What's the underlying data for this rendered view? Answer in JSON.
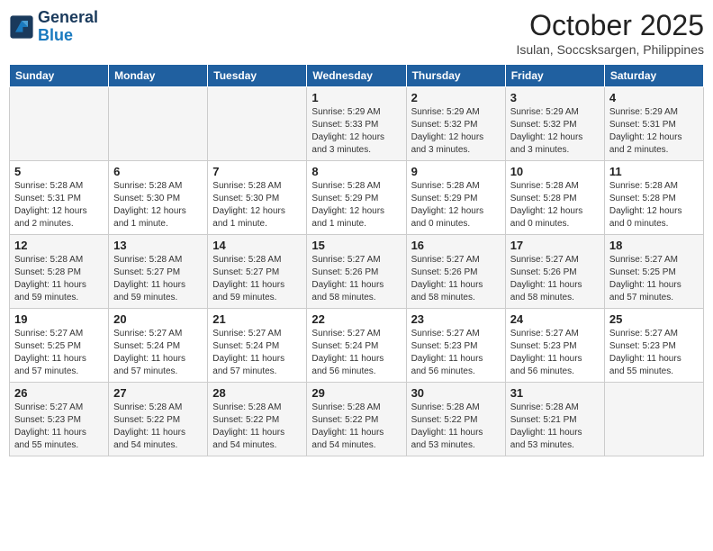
{
  "logo": {
    "line1": "General",
    "line2": "Blue"
  },
  "title": "October 2025",
  "location": "Isulan, Soccsksargen, Philippines",
  "weekdays": [
    "Sunday",
    "Monday",
    "Tuesday",
    "Wednesday",
    "Thursday",
    "Friday",
    "Saturday"
  ],
  "weeks": [
    [
      {
        "day": "",
        "sunrise": "",
        "sunset": "",
        "daylight": ""
      },
      {
        "day": "",
        "sunrise": "",
        "sunset": "",
        "daylight": ""
      },
      {
        "day": "",
        "sunrise": "",
        "sunset": "",
        "daylight": ""
      },
      {
        "day": "1",
        "sunrise": "Sunrise: 5:29 AM",
        "sunset": "Sunset: 5:33 PM",
        "daylight": "Daylight: 12 hours and 3 minutes."
      },
      {
        "day": "2",
        "sunrise": "Sunrise: 5:29 AM",
        "sunset": "Sunset: 5:32 PM",
        "daylight": "Daylight: 12 hours and 3 minutes."
      },
      {
        "day": "3",
        "sunrise": "Sunrise: 5:29 AM",
        "sunset": "Sunset: 5:32 PM",
        "daylight": "Daylight: 12 hours and 3 minutes."
      },
      {
        "day": "4",
        "sunrise": "Sunrise: 5:29 AM",
        "sunset": "Sunset: 5:31 PM",
        "daylight": "Daylight: 12 hours and 2 minutes."
      }
    ],
    [
      {
        "day": "5",
        "sunrise": "Sunrise: 5:28 AM",
        "sunset": "Sunset: 5:31 PM",
        "daylight": "Daylight: 12 hours and 2 minutes."
      },
      {
        "day": "6",
        "sunrise": "Sunrise: 5:28 AM",
        "sunset": "Sunset: 5:30 PM",
        "daylight": "Daylight: 12 hours and 1 minute."
      },
      {
        "day": "7",
        "sunrise": "Sunrise: 5:28 AM",
        "sunset": "Sunset: 5:30 PM",
        "daylight": "Daylight: 12 hours and 1 minute."
      },
      {
        "day": "8",
        "sunrise": "Sunrise: 5:28 AM",
        "sunset": "Sunset: 5:29 PM",
        "daylight": "Daylight: 12 hours and 1 minute."
      },
      {
        "day": "9",
        "sunrise": "Sunrise: 5:28 AM",
        "sunset": "Sunset: 5:29 PM",
        "daylight": "Daylight: 12 hours and 0 minutes."
      },
      {
        "day": "10",
        "sunrise": "Sunrise: 5:28 AM",
        "sunset": "Sunset: 5:28 PM",
        "daylight": "Daylight: 12 hours and 0 minutes."
      },
      {
        "day": "11",
        "sunrise": "Sunrise: 5:28 AM",
        "sunset": "Sunset: 5:28 PM",
        "daylight": "Daylight: 12 hours and 0 minutes."
      }
    ],
    [
      {
        "day": "12",
        "sunrise": "Sunrise: 5:28 AM",
        "sunset": "Sunset: 5:28 PM",
        "daylight": "Daylight: 11 hours and 59 minutes."
      },
      {
        "day": "13",
        "sunrise": "Sunrise: 5:28 AM",
        "sunset": "Sunset: 5:27 PM",
        "daylight": "Daylight: 11 hours and 59 minutes."
      },
      {
        "day": "14",
        "sunrise": "Sunrise: 5:28 AM",
        "sunset": "Sunset: 5:27 PM",
        "daylight": "Daylight: 11 hours and 59 minutes."
      },
      {
        "day": "15",
        "sunrise": "Sunrise: 5:27 AM",
        "sunset": "Sunset: 5:26 PM",
        "daylight": "Daylight: 11 hours and 58 minutes."
      },
      {
        "day": "16",
        "sunrise": "Sunrise: 5:27 AM",
        "sunset": "Sunset: 5:26 PM",
        "daylight": "Daylight: 11 hours and 58 minutes."
      },
      {
        "day": "17",
        "sunrise": "Sunrise: 5:27 AM",
        "sunset": "Sunset: 5:26 PM",
        "daylight": "Daylight: 11 hours and 58 minutes."
      },
      {
        "day": "18",
        "sunrise": "Sunrise: 5:27 AM",
        "sunset": "Sunset: 5:25 PM",
        "daylight": "Daylight: 11 hours and 57 minutes."
      }
    ],
    [
      {
        "day": "19",
        "sunrise": "Sunrise: 5:27 AM",
        "sunset": "Sunset: 5:25 PM",
        "daylight": "Daylight: 11 hours and 57 minutes."
      },
      {
        "day": "20",
        "sunrise": "Sunrise: 5:27 AM",
        "sunset": "Sunset: 5:24 PM",
        "daylight": "Daylight: 11 hours and 57 minutes."
      },
      {
        "day": "21",
        "sunrise": "Sunrise: 5:27 AM",
        "sunset": "Sunset: 5:24 PM",
        "daylight": "Daylight: 11 hours and 57 minutes."
      },
      {
        "day": "22",
        "sunrise": "Sunrise: 5:27 AM",
        "sunset": "Sunset: 5:24 PM",
        "daylight": "Daylight: 11 hours and 56 minutes."
      },
      {
        "day": "23",
        "sunrise": "Sunrise: 5:27 AM",
        "sunset": "Sunset: 5:23 PM",
        "daylight": "Daylight: 11 hours and 56 minutes."
      },
      {
        "day": "24",
        "sunrise": "Sunrise: 5:27 AM",
        "sunset": "Sunset: 5:23 PM",
        "daylight": "Daylight: 11 hours and 56 minutes."
      },
      {
        "day": "25",
        "sunrise": "Sunrise: 5:27 AM",
        "sunset": "Sunset: 5:23 PM",
        "daylight": "Daylight: 11 hours and 55 minutes."
      }
    ],
    [
      {
        "day": "26",
        "sunrise": "Sunrise: 5:27 AM",
        "sunset": "Sunset: 5:23 PM",
        "daylight": "Daylight: 11 hours and 55 minutes."
      },
      {
        "day": "27",
        "sunrise": "Sunrise: 5:28 AM",
        "sunset": "Sunset: 5:22 PM",
        "daylight": "Daylight: 11 hours and 54 minutes."
      },
      {
        "day": "28",
        "sunrise": "Sunrise: 5:28 AM",
        "sunset": "Sunset: 5:22 PM",
        "daylight": "Daylight: 11 hours and 54 minutes."
      },
      {
        "day": "29",
        "sunrise": "Sunrise: 5:28 AM",
        "sunset": "Sunset: 5:22 PM",
        "daylight": "Daylight: 11 hours and 54 minutes."
      },
      {
        "day": "30",
        "sunrise": "Sunrise: 5:28 AM",
        "sunset": "Sunset: 5:22 PM",
        "daylight": "Daylight: 11 hours and 53 minutes."
      },
      {
        "day": "31",
        "sunrise": "Sunrise: 5:28 AM",
        "sunset": "Sunset: 5:21 PM",
        "daylight": "Daylight: 11 hours and 53 minutes."
      },
      {
        "day": "",
        "sunrise": "",
        "sunset": "",
        "daylight": ""
      }
    ]
  ]
}
